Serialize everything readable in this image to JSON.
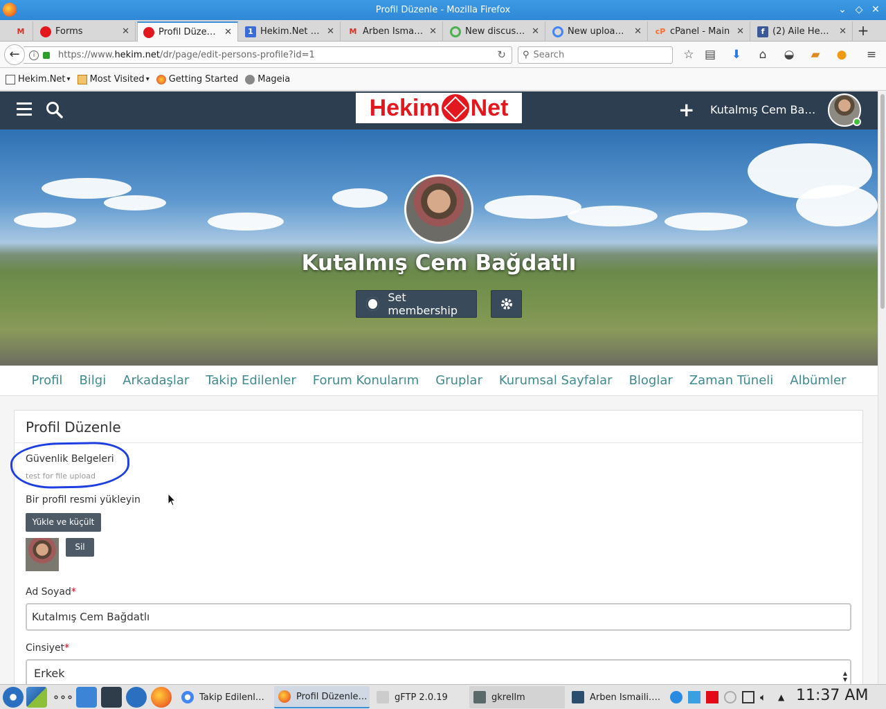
{
  "window": {
    "title": "Profil Düzenle - Mozilla Firefox"
  },
  "tabs": [
    {
      "label": "",
      "icon": "gmail-icon",
      "active": false
    },
    {
      "label": "Forms",
      "icon": "hekim-icon",
      "active": false
    },
    {
      "label": "Profil Düze…",
      "icon": "hekim-icon",
      "active": true
    },
    {
      "label": "Hekim.Net …",
      "icon": "calendar-icon",
      "active": false
    },
    {
      "label": "Arben Isma…",
      "icon": "gmail-icon",
      "active": false
    },
    {
      "label": "New discus…",
      "icon": "google-circle-icon",
      "active": false
    },
    {
      "label": "New uploa…",
      "icon": "google-circle-icon",
      "active": false
    },
    {
      "label": "cPanel - Main",
      "icon": "cpanel-icon",
      "active": false
    },
    {
      "label": "(2) Aile He…",
      "icon": "facebook-icon",
      "active": false
    }
  ],
  "nav": {
    "url_prefix": "https://www.",
    "url_host": "hekim.net",
    "url_path": "/dr/page/edit-persons-profile?id=1",
    "search_placeholder": "Search"
  },
  "bookmarks": [
    {
      "label": "Hekim.Net",
      "dropdown": true
    },
    {
      "label": "Most Visited",
      "dropdown": true
    },
    {
      "label": "Getting Started",
      "dropdown": false
    },
    {
      "label": "Mageia",
      "dropdown": false
    }
  ],
  "site": {
    "logo_left": "Hekim",
    "logo_right": "Net",
    "user_name": "Kutalmış Cem Bağd…"
  },
  "cover": {
    "name": "Kutalmış Cem Bağdatlı",
    "membership_label": "Set membership"
  },
  "profile_nav": [
    "Profil",
    "Bilgi",
    "Arkadaşlar",
    "Takip Edilenler",
    "Forum Konularım",
    "Gruplar",
    "Kurumsal Sayfalar",
    "Bloglar",
    "Zaman Tüneli",
    "Albümler"
  ],
  "form": {
    "title": "Profil Düzenle",
    "security_title": "Güvenlik Belgeleri",
    "security_desc": "test for file upload",
    "upload_label": "Bir profil resmi yükleyin",
    "upload_button": "Yükle ve küçült",
    "delete_button": "Sil",
    "name_label": "Ad Soyad",
    "name_value": "Kutalmış Cem Bağdatlı",
    "gender_label": "Cinsiyet",
    "gender_value": "Erkek",
    "required_mark": "*"
  },
  "taskbar": {
    "tasks": [
      {
        "label": "Takip Edilenl…",
        "active": false
      },
      {
        "label": "Profil Düzenle…",
        "active": true
      },
      {
        "label": "gFTP 2.0.19",
        "active": false
      },
      {
        "label": "gkrellm",
        "active": false
      },
      {
        "label": "Arben Ismaili….",
        "active": false
      }
    ],
    "clock": "11:37 AM"
  },
  "colors": {
    "header_bg": "#2c3e50",
    "link": "#3e8a8e",
    "highlight": "#1e3fe0",
    "logo_red": "#e3181f"
  }
}
